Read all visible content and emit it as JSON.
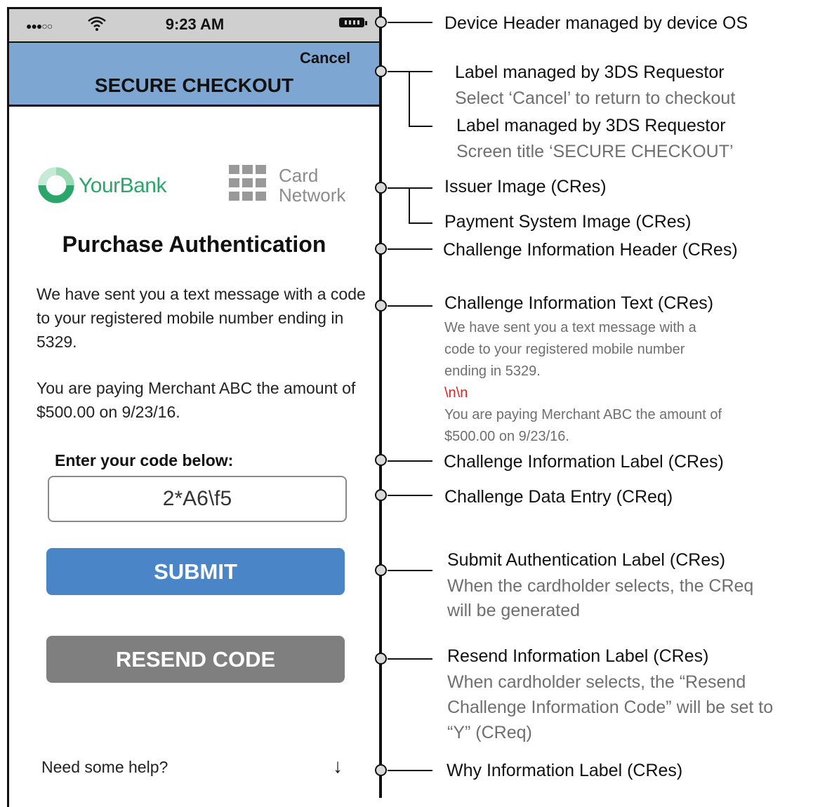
{
  "status_bar": {
    "signal": "●●●○○",
    "time": "9:23 AM"
  },
  "header": {
    "cancel_label": "Cancel",
    "title": "SECURE CHECKOUT"
  },
  "logos": {
    "issuer_name": "YourBank",
    "network_line1": "Card",
    "network_line2": "Network"
  },
  "challenge": {
    "header": "Purchase Authentication",
    "text_1": "We have sent you a text message with a code to your registered mobile number ending in 5329.",
    "text_2": "You are paying Merchant ABC the amount of $500.00 on 9/23/16.",
    "label": "Enter your code below:",
    "entry_value": "2*A6\\f5",
    "submit_label": "SUBMIT",
    "resend_label": "RESEND CODE",
    "help_label": "Need some help?",
    "help_arrow": "↓"
  },
  "annotations": {
    "device_header": "Device Header managed by device OS",
    "label_3ds_1": "Label managed by 3DS Requestor",
    "label_3ds_1_sub": "Select ‘Cancel’ to return to checkout",
    "label_3ds_2": "Label managed by 3DS Requestor",
    "label_3ds_2_sub": "Screen title ‘SECURE CHECKOUT’",
    "issuer_image": "Issuer Image (CRes)",
    "payment_system_image": "Payment System Image (CRes)",
    "ch_info_header": "Challenge Information Header (CRes)",
    "ch_info_text": "Challenge Information Text (CRes)",
    "ch_info_text_l1": "We have sent you a text message with a",
    "ch_info_text_l2": "code to your registered mobile number",
    "ch_info_text_l3": "ending in 5329.",
    "ch_info_text_sep": "\\n\\n",
    "ch_info_text_l4": "You are paying Merchant ABC the amount of",
    "ch_info_text_l5": "$500.00 on 9/23/16.",
    "ch_info_label": "Challenge Information Label (CRes)",
    "ch_data_entry": "Challenge Data Entry (CReq)",
    "submit_auth_label": "Submit Authentication Label (CRes)",
    "submit_auth_sub_1": "When the cardholder selects, the CReq",
    "submit_auth_sub_2": "will be generated",
    "resend_info_label": "Resend Information Label (CRes)",
    "resend_sub_1": "When cardholder selects, the “Resend",
    "resend_sub_2": "Challenge Information Code” will be set to",
    "resend_sub_3": "“Y” (CReq)",
    "why_info_label": "Why Information Label (CRes)"
  }
}
